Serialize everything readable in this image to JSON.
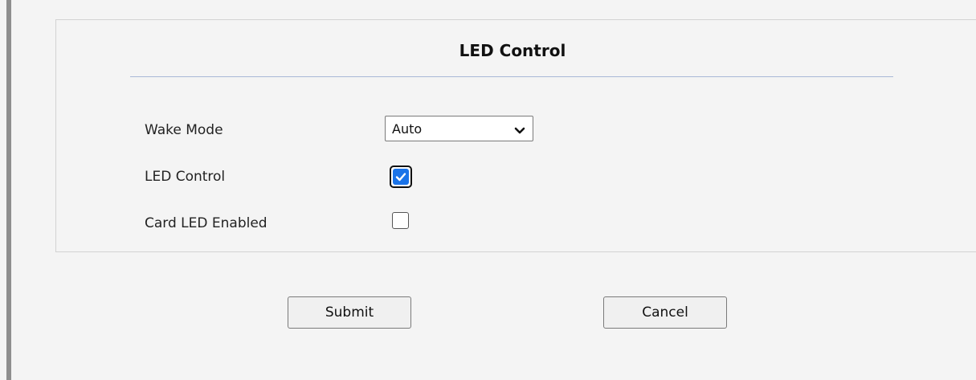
{
  "section": {
    "title": "LED Control"
  },
  "form": {
    "wake_mode": {
      "label": "Wake Mode",
      "selected": "Auto"
    },
    "led_control": {
      "label": "LED Control",
      "checked": true
    },
    "card_led_enabled": {
      "label": "Card LED Enabled",
      "checked": false
    }
  },
  "actions": {
    "submit_label": "Submit",
    "cancel_label": "Cancel"
  },
  "colors": {
    "accent": "#1a73e8",
    "divider": "#a9b8d6"
  },
  "icons": {
    "select_arrow": "chevron-down-icon",
    "check": "checkmark-icon"
  }
}
